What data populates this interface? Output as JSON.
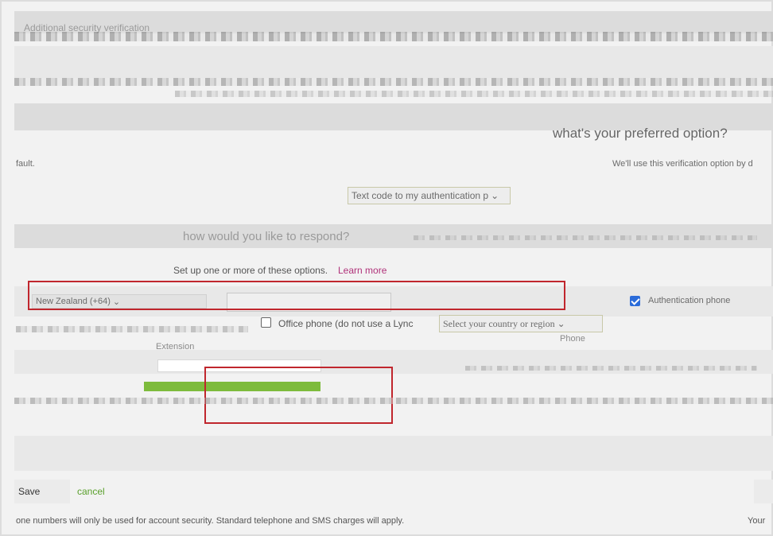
{
  "header": {
    "title": "Additional security verification"
  },
  "preferred": {
    "heading": "what's your preferred option?",
    "description_left": "fault.",
    "description_right": "We'll use this verification option by d",
    "select_value": "Text code to my authentication p"
  },
  "methods": {
    "heading": "how would you like to respond?",
    "setup_text": "Set up one or more of these options.",
    "learn_more": "Learn more"
  },
  "auth_phone": {
    "country": "New Zealand (+64)",
    "label": "Authentication phone"
  },
  "office_phone": {
    "label": "Office phone (do not use a Lync",
    "country_placeholder": "Select your country or region",
    "extension_label": "Extension",
    "phone_label": "Phone"
  },
  "actions": {
    "save": "Save",
    "cancel": "cancel"
  },
  "footer": {
    "note_left": "one numbers will only be used for account security. Standard telephone and SMS charges will apply.",
    "note_right": "Your "
  },
  "colors": {
    "highlight": "#c0262d",
    "green": "#7dbb3c",
    "link": "#b0327a",
    "checkbox": "#2b6cd9"
  }
}
